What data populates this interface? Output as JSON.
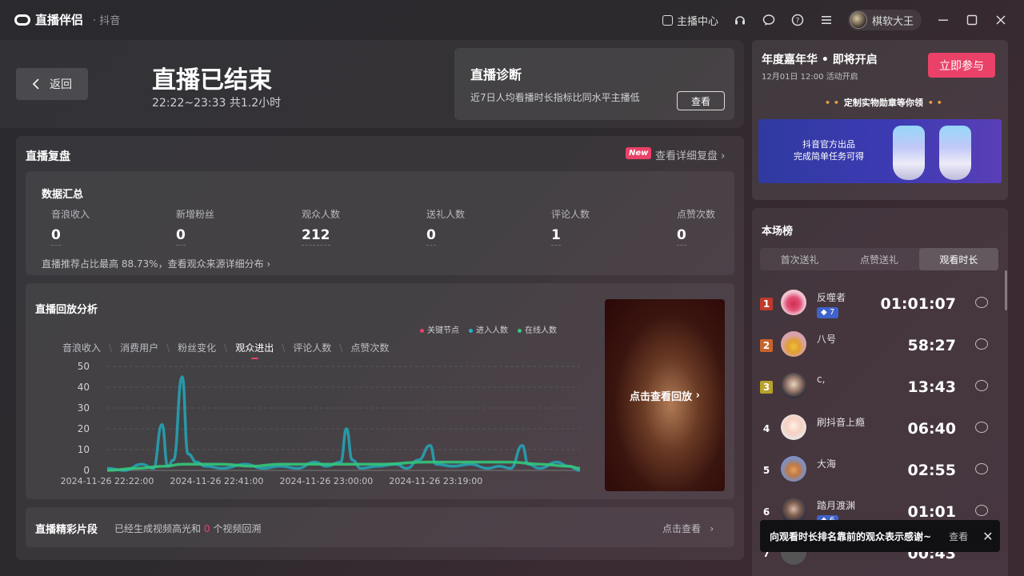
{
  "app": {
    "name": "直播伴侣",
    "platform": "· 抖音"
  },
  "titlebar": {
    "host_center": "主播中心",
    "user_name": "棋软大王"
  },
  "header": {
    "back_label": "返回",
    "title": "直播已结束",
    "time_range": "22:22~23:33 共1.2小时"
  },
  "diagnosis": {
    "title": "直播诊断",
    "text": "近7日人均看播时长指标比同水平主播低",
    "button": "查看"
  },
  "review": {
    "title": "直播复盘",
    "new_badge": "New",
    "detail_link": "查看详细复盘"
  },
  "summary": {
    "title": "数据汇总",
    "metrics": [
      {
        "label": "音浪收入",
        "value": "0"
      },
      {
        "label": "新增粉丝",
        "value": "0"
      },
      {
        "label": "观众人数",
        "value": "212"
      },
      {
        "label": "送礼人数",
        "value": "0"
      },
      {
        "label": "评论人数",
        "value": "1"
      },
      {
        "label": "点赞次数",
        "value": "0"
      }
    ],
    "note": "直播推荐占比最高 88.73%，查看观众来源详细分布"
  },
  "replay": {
    "title": "直播回放分析",
    "tabs": [
      "音浪收入",
      "消费用户",
      "粉丝变化",
      "观众进出",
      "评论人数",
      "点赞次数"
    ],
    "active_tab": 3,
    "playback_label": "点击查看回放"
  },
  "chart_data": {
    "type": "line",
    "legend": [
      {
        "name": "关键节点",
        "color": "#ea4168"
      },
      {
        "name": "进入人数",
        "color": "#1fb5c9"
      },
      {
        "name": "在线人数",
        "color": "#34c77b"
      }
    ],
    "yticks": [
      0,
      10,
      20,
      30,
      40,
      50
    ],
    "xticks": [
      "2024-11-26 22:22:00",
      "2024-11-26 22:41:00",
      "2024-11-26 23:00:00",
      "2024-11-26 23:19:00"
    ],
    "ylim": [
      0,
      50
    ],
    "x_minutes_range": [
      0,
      72
    ],
    "series": [
      {
        "name": "进入人数",
        "color": "#1fb5c9",
        "points": [
          [
            0,
            1
          ],
          [
            3,
            0
          ],
          [
            6,
            3
          ],
          [
            8,
            1
          ],
          [
            9.5,
            22
          ],
          [
            10.5,
            2
          ],
          [
            11.5,
            5
          ],
          [
            13,
            45
          ],
          [
            14,
            8
          ],
          [
            15.5,
            4
          ],
          [
            17,
            2
          ],
          [
            20,
            1
          ],
          [
            24,
            3
          ],
          [
            27,
            1
          ],
          [
            30,
            2
          ],
          [
            33,
            1
          ],
          [
            36,
            4
          ],
          [
            38,
            2
          ],
          [
            40.5,
            4
          ],
          [
            41.5,
            20
          ],
          [
            42.5,
            5
          ],
          [
            44,
            1
          ],
          [
            47,
            2
          ],
          [
            50,
            3
          ],
          [
            52,
            1
          ],
          [
            54,
            5
          ],
          [
            56,
            12
          ],
          [
            57,
            3
          ],
          [
            60,
            2
          ],
          [
            63,
            3
          ],
          [
            66,
            1
          ],
          [
            68,
            2
          ],
          [
            70,
            1
          ],
          [
            72,
            12
          ],
          [
            73,
            3
          ],
          [
            75,
            1
          ],
          [
            78,
            4
          ],
          [
            80,
            2
          ],
          [
            82,
            0
          ]
        ]
      },
      {
        "name": "在线人数",
        "color": "#34c77b",
        "points": [
          [
            0,
            0
          ],
          [
            5,
            1
          ],
          [
            10,
            2
          ],
          [
            13,
            3
          ],
          [
            16,
            3
          ],
          [
            20,
            3
          ],
          [
            25,
            2
          ],
          [
            30,
            3
          ],
          [
            35,
            3
          ],
          [
            40,
            3
          ],
          [
            43,
            3
          ],
          [
            48,
            3
          ],
          [
            55,
            4
          ],
          [
            60,
            4
          ],
          [
            65,
            4
          ],
          [
            70,
            4
          ],
          [
            75,
            3
          ],
          [
            80,
            2
          ],
          [
            82,
            1
          ]
        ]
      }
    ]
  },
  "clips": {
    "title": "直播精彩片段",
    "note_prefix": "已经生成视频高光和",
    "note_count": "0",
    "note_suffix": "个视频回溯",
    "link": "点击查看"
  },
  "promo": {
    "title": "年度嘉年华 • 即将开启",
    "date": "12月01日 12:00 活动开启",
    "join_button": "立即参与",
    "tag": "定制实物勋章等你领",
    "banner_line1": "抖音官方出品",
    "banner_line2": "完成简单任务可得"
  },
  "ranking": {
    "title": "本场榜",
    "tabs": [
      "首次送礼",
      "点赞送礼",
      "观看时长"
    ],
    "active_tab": 2,
    "rows": [
      {
        "rank": "1",
        "name": "反噬者",
        "badge": "◆ 7",
        "time": "01:01:07"
      },
      {
        "rank": "2",
        "name": "八号",
        "badge": "",
        "time": "58:27"
      },
      {
        "rank": "3",
        "name": "c,",
        "badge": "",
        "time": "13:43"
      },
      {
        "rank": "4",
        "name": "刷抖音上瘾",
        "badge": "",
        "time": "06:40"
      },
      {
        "rank": "5",
        "name": "大海",
        "badge": "",
        "time": "02:55"
      },
      {
        "rank": "6",
        "name": "踏月渡渊",
        "badge": "◆ 6",
        "time": "01:01"
      },
      {
        "rank": "7",
        "name": "",
        "badge": "",
        "time": "00:43"
      }
    ]
  },
  "toast": {
    "message": "向观看时长排名靠前的观众表示感谢~",
    "view": "查看"
  },
  "colors": {
    "accent": "#ea4168",
    "rank1": "#c0392b",
    "rank2": "#c8642b",
    "rank3": "#b9a12a",
    "badge_blue": "#3f63c9"
  }
}
